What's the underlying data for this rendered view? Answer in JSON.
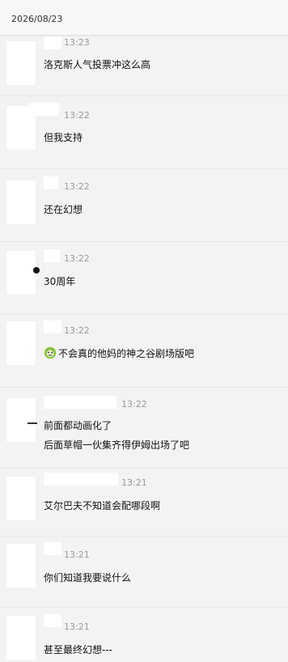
{
  "header": {
    "date": "2026/08/23"
  },
  "messages": [
    {
      "time": "13:23",
      "lines": [
        "洛克斯人气投票冲这么高"
      ]
    },
    {
      "time": "13:22",
      "lines": [
        "但我支持"
      ]
    },
    {
      "time": "13:22",
      "lines": [
        "还在幻想"
      ]
    },
    {
      "time": "13:22",
      "lines": [
        "30周年"
      ]
    },
    {
      "time": "13:22",
      "lines": [
        "不会真的他妈的神之谷剧场版吧"
      ]
    },
    {
      "time": "13:22",
      "lines": [
        "前面都动画化了",
        "后面草帽一伙集齐得伊姆出场了吧"
      ]
    },
    {
      "time": "13:21",
      "lines": [
        "艾尔巴夫不知道会配哪段啊"
      ]
    },
    {
      "time": "13:21",
      "lines": [
        "你们知道我要说什么"
      ]
    },
    {
      "time": "13:21",
      "lines": [
        "甚至最终幻想---"
      ]
    }
  ],
  "colors": {
    "background": "#f3f3f3",
    "header_background": "#f7f7f7",
    "time_text": "#9a9a9a",
    "message_text": "#111111",
    "emoji_green": "#8dc63f"
  },
  "icons": {
    "message_5": "green-face-emoji-icon"
  }
}
